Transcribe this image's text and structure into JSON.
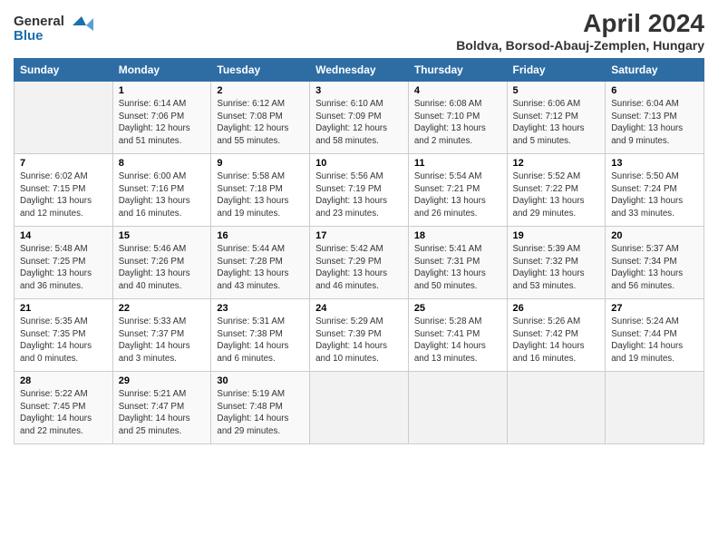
{
  "header": {
    "logo_line1": "General",
    "logo_line2": "Blue",
    "month_year": "April 2024",
    "location": "Boldva, Borsod-Abauj-Zemplen, Hungary"
  },
  "weekdays": [
    "Sunday",
    "Monday",
    "Tuesday",
    "Wednesday",
    "Thursday",
    "Friday",
    "Saturday"
  ],
  "weeks": [
    [
      {
        "day": "",
        "info": ""
      },
      {
        "day": "1",
        "info": "Sunrise: 6:14 AM\nSunset: 7:06 PM\nDaylight: 12 hours\nand 51 minutes."
      },
      {
        "day": "2",
        "info": "Sunrise: 6:12 AM\nSunset: 7:08 PM\nDaylight: 12 hours\nand 55 minutes."
      },
      {
        "day": "3",
        "info": "Sunrise: 6:10 AM\nSunset: 7:09 PM\nDaylight: 12 hours\nand 58 minutes."
      },
      {
        "day": "4",
        "info": "Sunrise: 6:08 AM\nSunset: 7:10 PM\nDaylight: 13 hours\nand 2 minutes."
      },
      {
        "day": "5",
        "info": "Sunrise: 6:06 AM\nSunset: 7:12 PM\nDaylight: 13 hours\nand 5 minutes."
      },
      {
        "day": "6",
        "info": "Sunrise: 6:04 AM\nSunset: 7:13 PM\nDaylight: 13 hours\nand 9 minutes."
      }
    ],
    [
      {
        "day": "7",
        "info": "Sunrise: 6:02 AM\nSunset: 7:15 PM\nDaylight: 13 hours\nand 12 minutes."
      },
      {
        "day": "8",
        "info": "Sunrise: 6:00 AM\nSunset: 7:16 PM\nDaylight: 13 hours\nand 16 minutes."
      },
      {
        "day": "9",
        "info": "Sunrise: 5:58 AM\nSunset: 7:18 PM\nDaylight: 13 hours\nand 19 minutes."
      },
      {
        "day": "10",
        "info": "Sunrise: 5:56 AM\nSunset: 7:19 PM\nDaylight: 13 hours\nand 23 minutes."
      },
      {
        "day": "11",
        "info": "Sunrise: 5:54 AM\nSunset: 7:21 PM\nDaylight: 13 hours\nand 26 minutes."
      },
      {
        "day": "12",
        "info": "Sunrise: 5:52 AM\nSunset: 7:22 PM\nDaylight: 13 hours\nand 29 minutes."
      },
      {
        "day": "13",
        "info": "Sunrise: 5:50 AM\nSunset: 7:24 PM\nDaylight: 13 hours\nand 33 minutes."
      }
    ],
    [
      {
        "day": "14",
        "info": "Sunrise: 5:48 AM\nSunset: 7:25 PM\nDaylight: 13 hours\nand 36 minutes."
      },
      {
        "day": "15",
        "info": "Sunrise: 5:46 AM\nSunset: 7:26 PM\nDaylight: 13 hours\nand 40 minutes."
      },
      {
        "day": "16",
        "info": "Sunrise: 5:44 AM\nSunset: 7:28 PM\nDaylight: 13 hours\nand 43 minutes."
      },
      {
        "day": "17",
        "info": "Sunrise: 5:42 AM\nSunset: 7:29 PM\nDaylight: 13 hours\nand 46 minutes."
      },
      {
        "day": "18",
        "info": "Sunrise: 5:41 AM\nSunset: 7:31 PM\nDaylight: 13 hours\nand 50 minutes."
      },
      {
        "day": "19",
        "info": "Sunrise: 5:39 AM\nSunset: 7:32 PM\nDaylight: 13 hours\nand 53 minutes."
      },
      {
        "day": "20",
        "info": "Sunrise: 5:37 AM\nSunset: 7:34 PM\nDaylight: 13 hours\nand 56 minutes."
      }
    ],
    [
      {
        "day": "21",
        "info": "Sunrise: 5:35 AM\nSunset: 7:35 PM\nDaylight: 14 hours\nand 0 minutes."
      },
      {
        "day": "22",
        "info": "Sunrise: 5:33 AM\nSunset: 7:37 PM\nDaylight: 14 hours\nand 3 minutes."
      },
      {
        "day": "23",
        "info": "Sunrise: 5:31 AM\nSunset: 7:38 PM\nDaylight: 14 hours\nand 6 minutes."
      },
      {
        "day": "24",
        "info": "Sunrise: 5:29 AM\nSunset: 7:39 PM\nDaylight: 14 hours\nand 10 minutes."
      },
      {
        "day": "25",
        "info": "Sunrise: 5:28 AM\nSunset: 7:41 PM\nDaylight: 14 hours\nand 13 minutes."
      },
      {
        "day": "26",
        "info": "Sunrise: 5:26 AM\nSunset: 7:42 PM\nDaylight: 14 hours\nand 16 minutes."
      },
      {
        "day": "27",
        "info": "Sunrise: 5:24 AM\nSunset: 7:44 PM\nDaylight: 14 hours\nand 19 minutes."
      }
    ],
    [
      {
        "day": "28",
        "info": "Sunrise: 5:22 AM\nSunset: 7:45 PM\nDaylight: 14 hours\nand 22 minutes."
      },
      {
        "day": "29",
        "info": "Sunrise: 5:21 AM\nSunset: 7:47 PM\nDaylight: 14 hours\nand 25 minutes."
      },
      {
        "day": "30",
        "info": "Sunrise: 5:19 AM\nSunset: 7:48 PM\nDaylight: 14 hours\nand 29 minutes."
      },
      {
        "day": "",
        "info": ""
      },
      {
        "day": "",
        "info": ""
      },
      {
        "day": "",
        "info": ""
      },
      {
        "day": "",
        "info": ""
      }
    ]
  ]
}
